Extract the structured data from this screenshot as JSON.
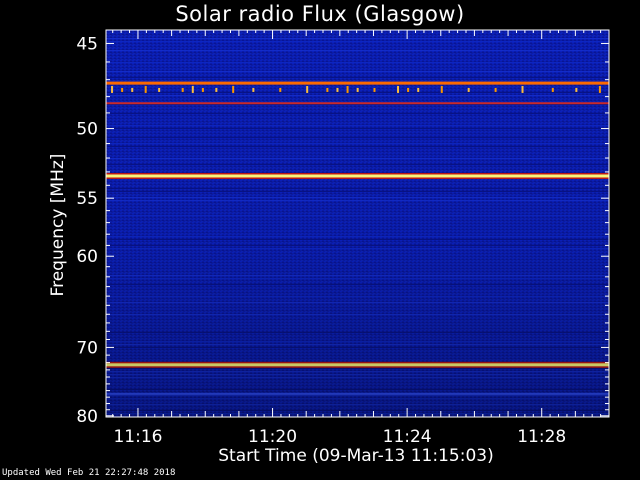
{
  "title": "Solar radio Flux (Glasgow)",
  "footer": {
    "updated": "Updated Wed Feb 21 22:27:48 2018"
  },
  "chart_data": {
    "type": "heatmap",
    "title": "Solar radio Flux (Glasgow)",
    "xlabel": "Start Time (09-Mar-13 11:15:03)",
    "ylabel": "Frequency [MHz]",
    "x_tick_labels": [
      "11:16",
      "11:20",
      "11:24",
      "11:28"
    ],
    "x_tick_minutes": [
      16,
      20,
      24,
      28
    ],
    "x_range_minutes": [
      15.05,
      30.0
    ],
    "y_tick_labels": [
      "45",
      "50",
      "55",
      "60",
      "70",
      "80"
    ],
    "y_tick_values": [
      45,
      50,
      55,
      60,
      70,
      80
    ],
    "y_range_mhz": [
      44.3,
      80.2
    ],
    "y_scale": "reciprocal",
    "background_color": "#0a1aa0",
    "interference_bands_mhz": [
      {
        "freq": 47.2,
        "intensity": "high",
        "color": "#ff6a00"
      },
      {
        "freq": 48.4,
        "intensity": "medium",
        "color": "#cc2a2a"
      },
      {
        "freq": 53.3,
        "intensity": "very high",
        "color": "#ffff80"
      },
      {
        "freq": 72.3,
        "intensity": "very high",
        "color": "#ffff80"
      },
      {
        "freq": 76.5,
        "intensity": "low",
        "color": "#3050ff"
      }
    ]
  }
}
